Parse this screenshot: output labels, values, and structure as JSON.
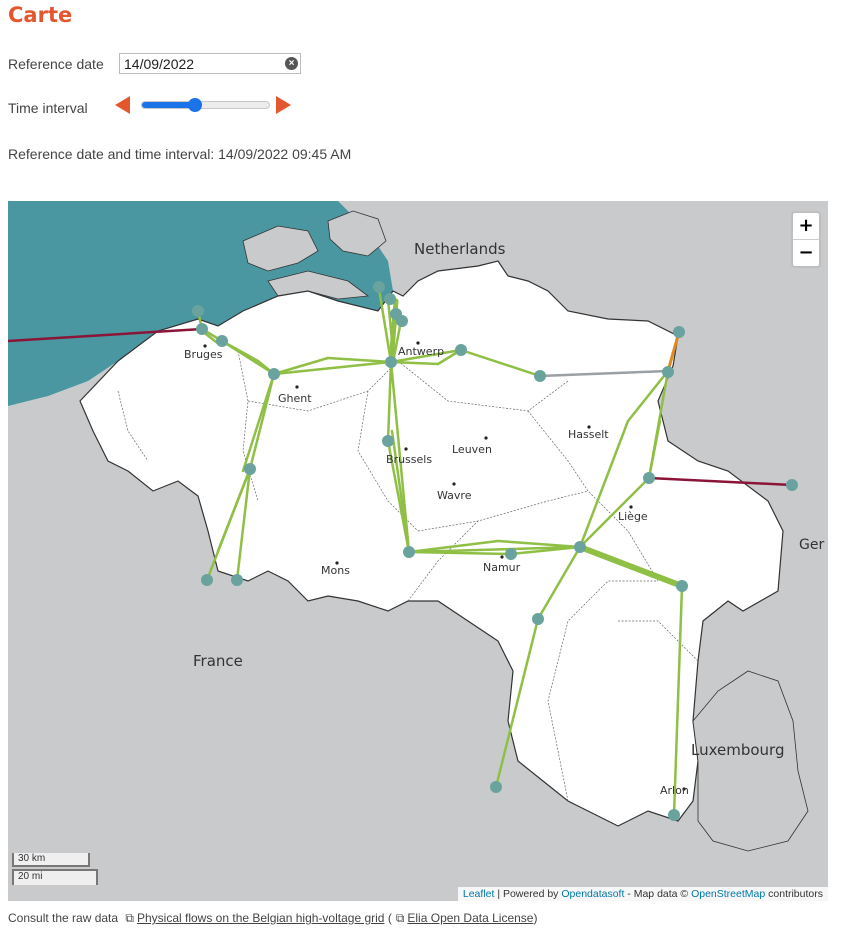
{
  "page": {
    "title": "Carte"
  },
  "controls": {
    "reference_date_label": "Reference date",
    "reference_date_value": "14/09/2022",
    "time_interval_label": "Time interval",
    "time_interval_slider_fraction": 0.42,
    "summary": "Reference date and time interval: 14/09/2022 09:45 AM"
  },
  "map": {
    "labels": {
      "netherlands": "Netherlands",
      "france": "France",
      "luxembourg": "Luxembourg",
      "germany_partial": "Ger",
      "bruges": "Bruges",
      "ghent": "Ghent",
      "antwerp": "Antwerp",
      "brussels": "Brussels",
      "leuven": "Leuven",
      "hasselt": "Hasselt",
      "wavre": "Wavre",
      "liege": "Liège",
      "mons": "Mons",
      "namur": "Namur",
      "arlon": "Arlon"
    },
    "zoom_in": "+",
    "zoom_out": "−",
    "scale_km": "30 km",
    "scale_mi": "20 mi",
    "attribution": {
      "leaflet": "Leaflet",
      "sep1": " | Powered by ",
      "opendatasoft": "Opendatasoft",
      "sep2": " - Map data © ",
      "osm": "OpenStreetMap",
      "tail": " contributors"
    },
    "colors": {
      "sea": "#4a97a1",
      "land_out": "#c9cacc",
      "belgium": "#ffffff",
      "line_green": "#8fbf45",
      "line_grey": "#9aa0a3",
      "line_maroon": "#8b1538",
      "line_orange": "#e08a1e",
      "node": "#6aa39e"
    }
  },
  "footer": {
    "prefix": "Consult the raw data",
    "link1": "Physical flows on the Belgian high-voltage grid",
    "paren_open": "(",
    "link2": "Elia Open Data License",
    "paren_close": ")"
  }
}
